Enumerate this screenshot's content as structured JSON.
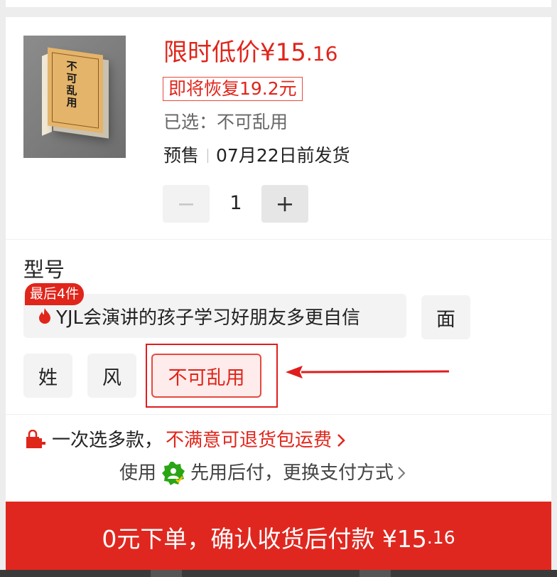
{
  "product": {
    "book_cover_text": "不可乱用",
    "price_label": "限时低价¥15",
    "price_decimals": ".16",
    "restore_text": "即将恢复19.2元",
    "selected_text": "已选：不可乱用",
    "presale_label": "预售",
    "ship_text": "07月22日前发货",
    "quantity": "1"
  },
  "spec": {
    "title": "型号",
    "badge": "最后4件",
    "options": [
      "YJL会演讲的孩子学习好朋友多更自信",
      "面",
      "姓",
      "风",
      "不可乱用"
    ],
    "selected": "不可乱用"
  },
  "return_line": {
    "prefix": "一次选多款，",
    "highlight": "不满意可退货包运费"
  },
  "pay_line": {
    "prefix": "使用",
    "suffix": "先用后付，更换支付方式"
  },
  "order": {
    "label": "0元下单，确认收货后付款 ¥15",
    "price_decimals": ".16"
  },
  "colors": {
    "accent": "#e0251b",
    "button": "#e0271f",
    "selected_bg": "#fdeceb",
    "chip_bg": "#f3f3f3",
    "credit_green": "#2aa515"
  },
  "icons": [
    "book-cover-image",
    "minus-icon",
    "plus-icon",
    "flame-icon",
    "arrow-annotation",
    "bag-icon",
    "chevron-right-icon",
    "credit-pay-icon"
  ]
}
